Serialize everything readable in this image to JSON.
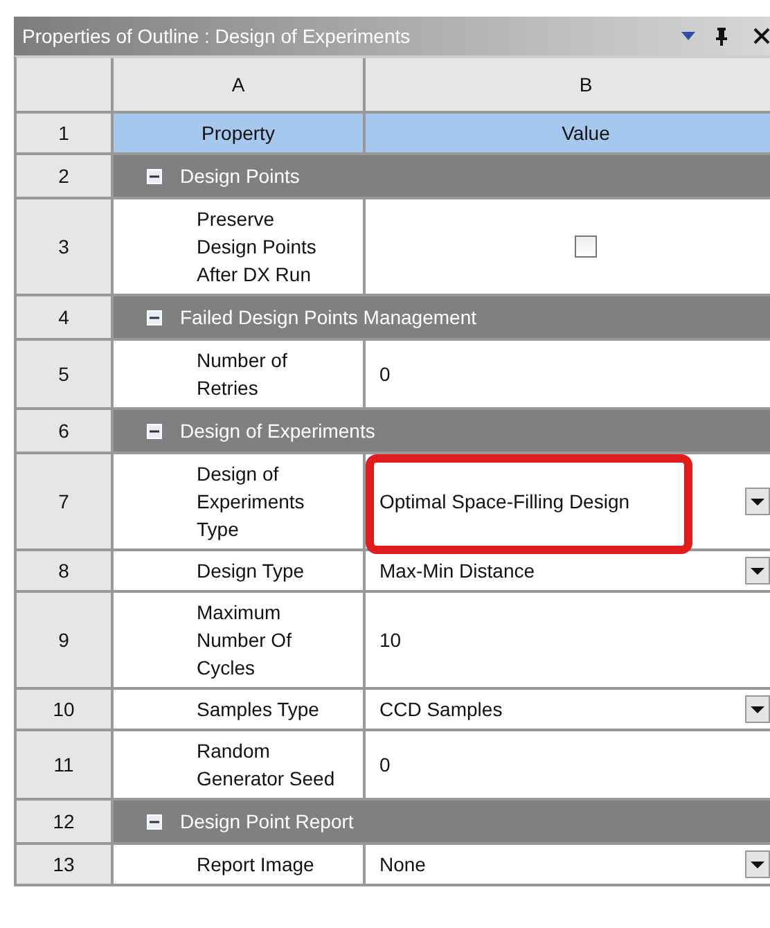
{
  "window": {
    "title": "Properties of Outline : Design of Experiments"
  },
  "table": {
    "columns": [
      "A",
      "B"
    ],
    "rows": [
      {
        "number": "1",
        "kind": "header",
        "property": "Property",
        "value": "Value"
      },
      {
        "number": "2",
        "kind": "group",
        "label": "Design Points",
        "expanded": true
      },
      {
        "number": "3",
        "kind": "checkbox",
        "property": "Preserve Design Points After DX Run",
        "checked": false
      },
      {
        "number": "4",
        "kind": "group",
        "label": "Failed Design Points Management",
        "expanded": true
      },
      {
        "number": "5",
        "kind": "text",
        "property": "Number of Retries",
        "value": "0"
      },
      {
        "number": "6",
        "kind": "group",
        "label": "Design of Experiments",
        "expanded": true
      },
      {
        "number": "7",
        "kind": "dropdown",
        "property": "Design of Experiments Type",
        "value": "Optimal Space-Filling Design",
        "highlighted": true
      },
      {
        "number": "8",
        "kind": "dropdown",
        "property": "Design Type",
        "value": "Max-Min Distance"
      },
      {
        "number": "9",
        "kind": "text",
        "property": "Maximum Number Of Cycles",
        "value": "10"
      },
      {
        "number": "10",
        "kind": "dropdown",
        "property": "Samples Type",
        "value": "CCD Samples"
      },
      {
        "number": "11",
        "kind": "text",
        "property": "Random Generator Seed",
        "value": "0"
      },
      {
        "number": "12",
        "kind": "group",
        "label": "Design Point Report",
        "expanded": true
      },
      {
        "number": "13",
        "kind": "dropdown",
        "property": "Report Image",
        "value": "None"
      }
    ]
  }
}
